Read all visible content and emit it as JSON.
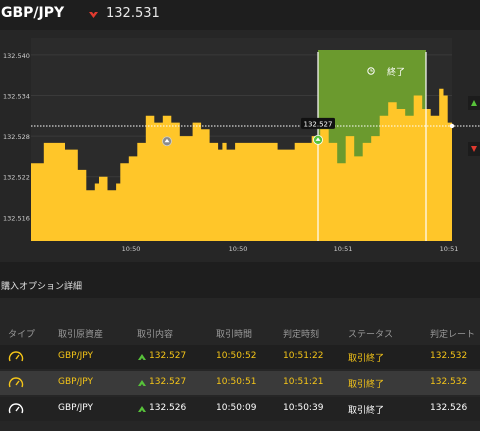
{
  "header": {
    "pair": "GBP/JPY",
    "current_rate": "132.531",
    "direction": "down"
  },
  "chart_data": {
    "type": "area",
    "y_ticks": [
      "132.540",
      "132.534",
      "132.528",
      "132.522",
      "132.516"
    ],
    "y_tick_values": [
      132.54,
      132.534,
      132.528,
      132.522,
      132.516
    ],
    "x_ticks": [
      "10:50",
      "10:50",
      "10:51",
      "10:51"
    ],
    "ylim": [
      132.5125,
      132.5425
    ],
    "current_line_value": 132.5295,
    "entry_marker": {
      "label": "132.527",
      "value": 132.527
    },
    "expired_panel": {
      "label": "終了"
    },
    "series": [
      {
        "values": [
          132.524,
          132.524,
          132.524,
          132.527,
          132.527,
          132.527,
          132.527,
          132.527,
          132.526,
          132.526,
          132.526,
          132.523,
          132.523,
          132.52,
          132.52,
          132.521,
          132.522,
          132.522,
          132.52,
          132.52,
          132.521,
          132.524,
          132.524,
          132.525,
          132.525,
          132.527,
          132.527,
          132.531,
          132.531,
          132.53,
          132.53,
          132.531,
          132.531,
          132.53,
          132.53,
          132.528,
          132.528,
          132.528,
          132.53,
          132.53,
          132.529,
          132.529,
          132.527,
          132.527,
          132.526,
          132.527,
          132.526,
          132.526,
          132.527,
          132.527,
          132.527,
          132.527,
          132.527,
          132.527,
          132.527,
          132.527,
          132.527,
          132.527,
          132.526,
          132.526,
          132.526,
          132.526,
          132.527,
          132.527,
          132.527,
          132.527,
          132.528,
          132.528,
          132.529,
          132.529,
          132.527,
          132.527,
          132.524,
          132.524,
          132.528,
          132.528,
          132.525,
          132.525,
          132.527,
          132.527,
          132.528,
          132.528,
          132.531,
          132.531,
          132.533,
          132.533,
          132.532,
          132.532,
          132.531,
          132.531,
          132.534,
          132.534,
          132.532,
          132.532,
          132.531,
          132.531,
          132.535,
          132.534,
          132.53,
          132.53
        ]
      }
    ]
  },
  "details": {
    "title": "購入オプション詳細",
    "headers": [
      "タイプ",
      "取引原資産",
      "取引内容",
      "取引時間",
      "判定時刻",
      "ステータス",
      "判定レート"
    ],
    "rows": [
      {
        "type_icon": "gauge-icon",
        "asset": "GBP/JPY",
        "content": "132.527",
        "time": "10:50:52",
        "judge_time": "10:51:22",
        "status": "取引終了",
        "rate": "132.532"
      },
      {
        "type_icon": "gauge-icon",
        "asset": "GBP/JPY",
        "content": "132.527",
        "time": "10:50:51",
        "judge_time": "10:51:21",
        "status": "取引終了",
        "rate": "132.532"
      },
      {
        "type_icon": "gauge-icon",
        "asset": "GBP/JPY",
        "content": "132.526",
        "time": "10:50:09",
        "judge_time": "10:50:39",
        "status": "取引終了",
        "rate": "132.526"
      }
    ]
  },
  "colors": {
    "area": "#ffc629",
    "expired": "#6b9a2e",
    "up": "#57c23a",
    "down": "#e03a2f",
    "gold_text": "#f5c518"
  }
}
